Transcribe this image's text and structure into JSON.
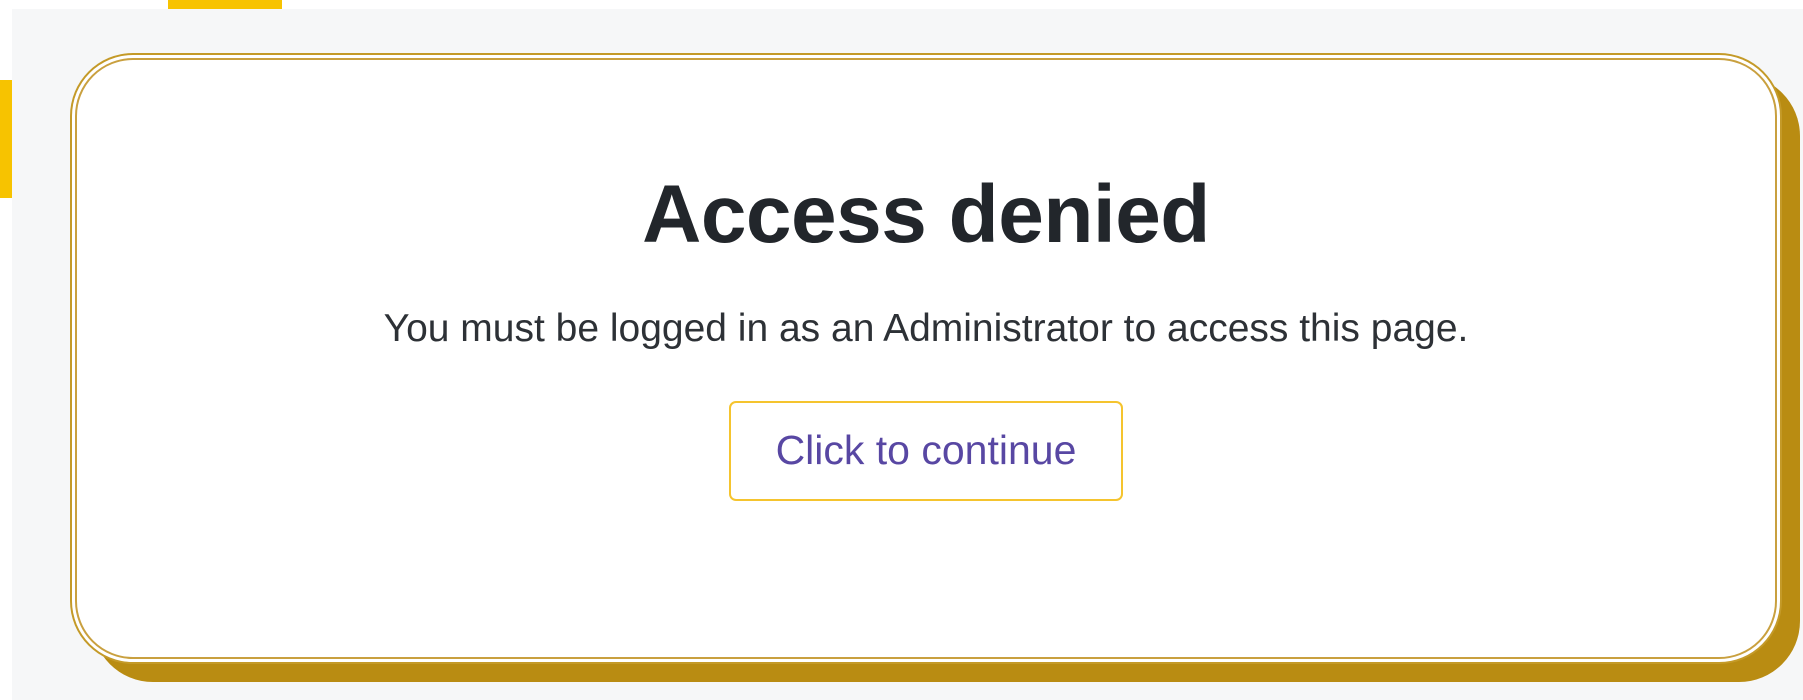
{
  "page": {
    "title": "Access denied",
    "message": "You must be logged in as an Administrator to access this page.",
    "continue_label": "Click to continue"
  },
  "colors": {
    "accent": "#f7c300",
    "card_border": "#c9a03f",
    "shadow": "#b98c12",
    "button_border": "#f5c42e",
    "button_text": "#5847a3",
    "title_text": "#22262b"
  }
}
